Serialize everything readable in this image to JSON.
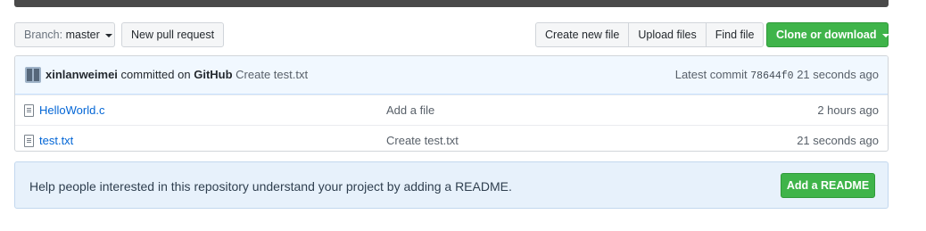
{
  "toolbar": {
    "branch_prefix": "Branch:",
    "branch_name": "master",
    "new_pull_request": "New pull request",
    "create_new_file": "Create new file",
    "upload_files": "Upload files",
    "find_file": "Find file",
    "clone_or_download": "Clone or download"
  },
  "commit": {
    "author": "xinlanweimei",
    "committed_on": "committed on",
    "platform": "GitHub",
    "message": "Create test.txt",
    "latest_label": "Latest commit",
    "sha": "78644f0",
    "time": "21 seconds ago"
  },
  "files": [
    {
      "name": "HelloWorld.c",
      "message": "Add a file",
      "age": "2 hours ago"
    },
    {
      "name": "test.txt",
      "message": "Create test.txt",
      "age": "21 seconds ago"
    }
  ],
  "readme": {
    "text": "Help people interested in this repository understand your project by adding a README.",
    "button": "Add a README"
  },
  "colors": {
    "primary_green": "#3fb44a",
    "link_blue": "#0366d6",
    "readme_bg": "#e7f1fb"
  }
}
